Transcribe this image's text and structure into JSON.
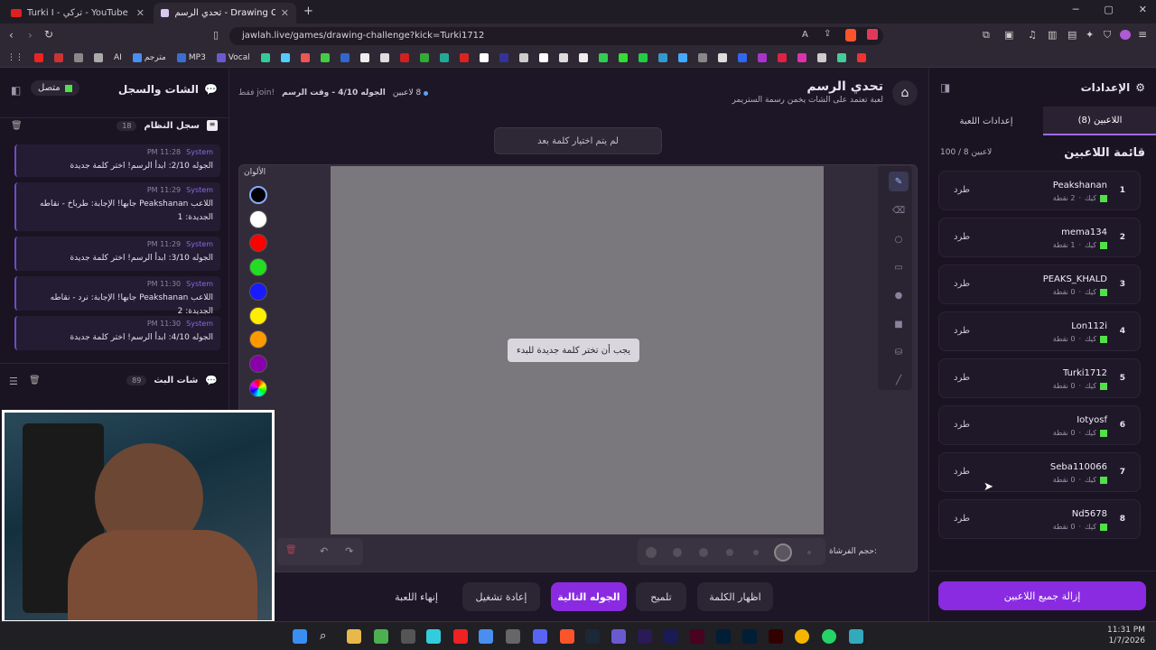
{
  "browser": {
    "tabs": [
      {
        "title": "Turki I - تركي - YouTube"
      },
      {
        "title": "تحدي الرسم - Drawing Challenge"
      }
    ],
    "new_tab": "+",
    "url": "jawlah.live/games/drawing-challenge?kick=Turki1712",
    "bookmarks": [
      "مترجم",
      "MP3",
      "Vocal",
      "AI"
    ]
  },
  "header": {
    "title": "تحدي الرسم",
    "subtitle": "لعبة تعتمد على الشات يخمن رسمة الستريمر",
    "players_count": "8 لاعبين",
    "round_info": "الجوله 4/10 - وقت الرسم",
    "join_info": "!join فقط"
  },
  "left_panel": {
    "title": "الشات والسجل",
    "status": "متصل",
    "system_log": {
      "title": "سجل النظام",
      "count": "18",
      "messages": [
        {
          "sender": "System",
          "time": "11:28 PM",
          "text": "الجوله 2/10: ابدأ الرسم! اختر كلمة جديدة"
        },
        {
          "sender": "System",
          "time": "11:29 PM",
          "text": "اللاعب Peakshanan جابها! الإجابة: طرباخ - نقاطه الجديدة: 1"
        },
        {
          "sender": "System",
          "time": "11:29 PM",
          "text": "الجوله 3/10: ابدأ الرسم! اختر كلمة جديدة"
        },
        {
          "sender": "System",
          "time": "11:30 PM",
          "text": "اللاعب Peakshanan جابها! الإجابة: نرد - نقاطه الجديدة: 2"
        },
        {
          "sender": "System",
          "time": "11:30 PM",
          "text": "الجوله 4/10: ابدأ الرسم! اختر كلمة جديدة"
        }
      ]
    },
    "live_chat": {
      "title": "شات البث",
      "count": "89"
    }
  },
  "canvas": {
    "word_placeholder": "لم يتم اختيار كلمة بعد",
    "colors_label": "الألوان",
    "colors": [
      "#000000",
      "#ffffff",
      "#ff0000",
      "#22dd22",
      "#1a1aff",
      "#ffee00",
      "#ff9900",
      "#8800aa"
    ],
    "center_message": "يجب أن تختر كلمة جديدة للبدء",
    "brush_size_label": "حجم الفرشاة:"
  },
  "actions": {
    "show_word": "اظهار الكلمة",
    "hint": "تلميح",
    "next_round": "الجوله التالية",
    "restart": "إعادة تشغيل",
    "end_game": "إنهاء اللعبة"
  },
  "right_panel": {
    "title": "الإعدادات",
    "tabs": {
      "players": "اللاعبين (8)",
      "game_settings": "إعدادات اللعبة"
    },
    "list_title": "قائمة اللاعبين",
    "list_count": "100 / 8 لاعبين",
    "kick_label": "طرد",
    "platform": "كيك",
    "players": [
      {
        "rank": "1",
        "name": "Peakshanan",
        "points": "2 نقطة"
      },
      {
        "rank": "2",
        "name": "mema134",
        "points": "1 نقطة"
      },
      {
        "rank": "3",
        "name": "PEAKS_KHALD",
        "points": "0 نقطة"
      },
      {
        "rank": "4",
        "name": "Lon112i",
        "points": "0 نقطة"
      },
      {
        "rank": "5",
        "name": "Turki1712",
        "points": "0 نقطة"
      },
      {
        "rank": "6",
        "name": "Iotyosf",
        "points": "0 نقطة"
      },
      {
        "rank": "7",
        "name": "Seba110066",
        "points": "0 نقطة"
      },
      {
        "rank": "8",
        "name": "Nd5678",
        "points": "0 نقطة"
      }
    ],
    "remove_all": "إزالة جميع اللاعبين"
  },
  "taskbar": {
    "time": "11:31 PM",
    "date": "1/7/2026"
  },
  "accent": "#8a2be2"
}
